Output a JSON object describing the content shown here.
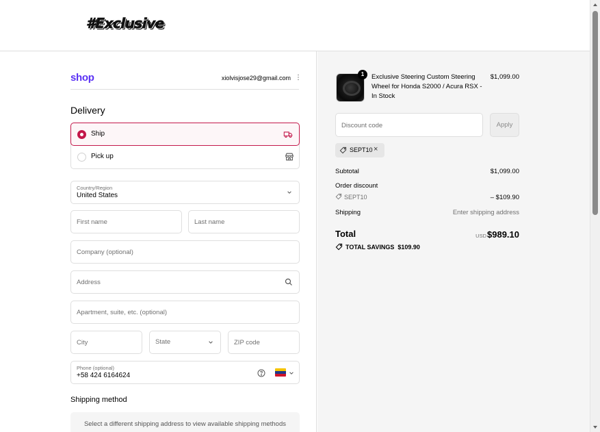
{
  "brand": {
    "logo_text": "#Exclusive"
  },
  "account": {
    "shop_logo": "shop",
    "email": "xiolvisjose29@gmail.com",
    "menu_icon": "kebab-icon"
  },
  "delivery": {
    "title": "Delivery",
    "options": [
      {
        "label": "Ship",
        "selected": true,
        "icon": "truck-icon"
      },
      {
        "label": "Pick up",
        "selected": false,
        "icon": "store-icon"
      }
    ]
  },
  "form": {
    "country": {
      "label": "Country/Region",
      "value": "United States"
    },
    "first_name": {
      "placeholder": "First name"
    },
    "last_name": {
      "placeholder": "Last name"
    },
    "company": {
      "placeholder": "Company (optional)"
    },
    "address": {
      "placeholder": "Address"
    },
    "apartment": {
      "placeholder": "Apartment, suite, etc. (optional)"
    },
    "city": {
      "placeholder": "City"
    },
    "state": {
      "placeholder": "State"
    },
    "zip": {
      "placeholder": "ZIP code"
    },
    "phone": {
      "label": "Phone (optional)",
      "value": "+58 424 6164624",
      "country_flag": "venezuela-flag"
    }
  },
  "shipping_method": {
    "title": "Shipping method",
    "message": "Select a different shipping address to view available shipping methods"
  },
  "cart": {
    "item": {
      "quantity": "1",
      "name": "Exclusive Steering Custom Steering Wheel for Honda S2000 / Acura RSX - In Stock",
      "price": "$1,099.00"
    },
    "discount_placeholder": "Discount code",
    "apply_label": "Apply",
    "applied_code": "SEPT10",
    "subtotal_label": "Subtotal",
    "subtotal_value": "$1,099.00",
    "order_discount_label": "Order discount",
    "order_discount_code": "SEPT10",
    "order_discount_value": "– $109.90",
    "shipping_label": "Shipping",
    "shipping_value": "Enter shipping address",
    "total_label": "Total",
    "total_currency": "USD",
    "total_value": "$989.10",
    "savings_label": "TOTAL SAVINGS",
    "savings_value": "$109.90"
  },
  "colors": {
    "accent": "#c3174a",
    "shop_purple": "#5a31f4",
    "summary_bg": "#f5f5f5"
  }
}
